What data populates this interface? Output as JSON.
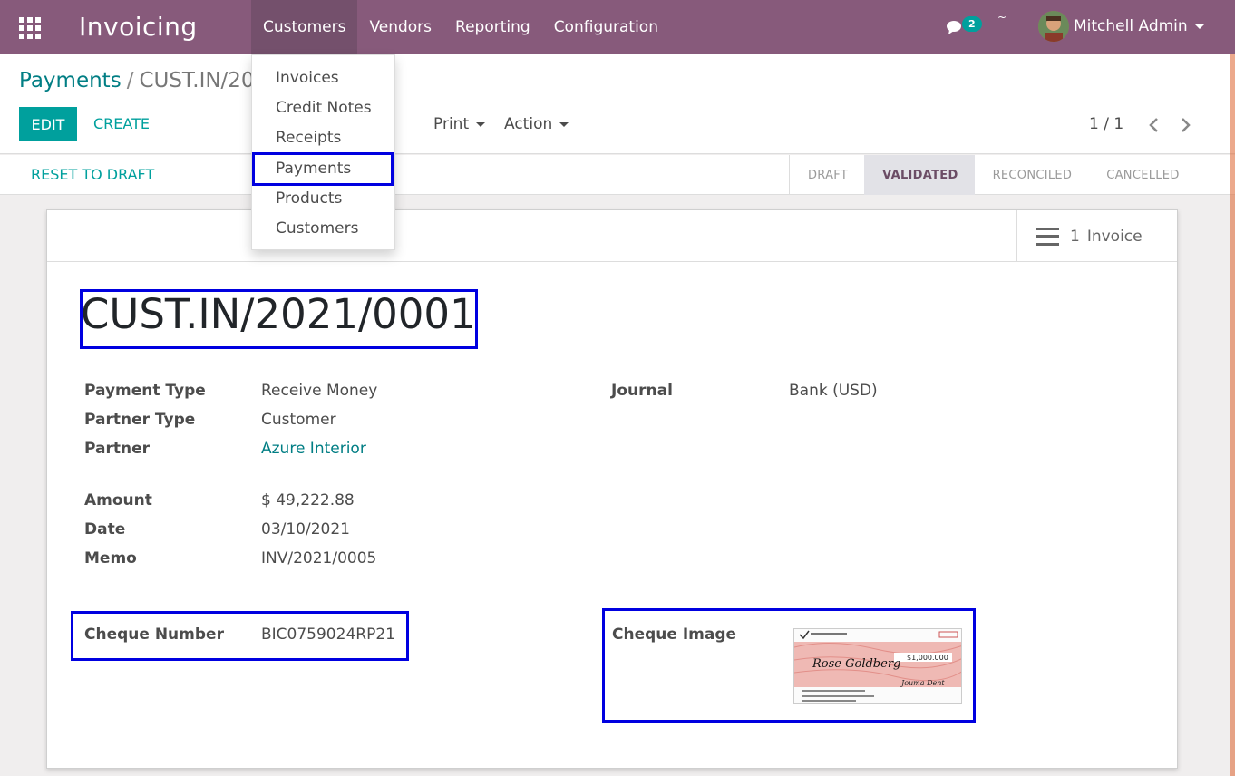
{
  "navbar": {
    "app_title": "Invoicing",
    "menu": [
      "Customers",
      "Vendors",
      "Reporting",
      "Configuration"
    ],
    "chat_count": "2",
    "tilde": "~",
    "user_name": "Mitchell Admin"
  },
  "breadcrumb": {
    "parent": "Payments",
    "separator": "/",
    "current": "CUST.IN/20"
  },
  "toolbar": {
    "edit_label": "EDIT",
    "create_label": "CREATE",
    "print_label": "Print",
    "action_label": "Action",
    "pager": "1 / 1"
  },
  "statusbar": {
    "reset_label": "RESET TO DRAFT",
    "stages": [
      "DRAFT",
      "VALIDATED",
      "RECONCILED",
      "CANCELLED"
    ],
    "current_stage": "VALIDATED"
  },
  "smart_button": {
    "count": "1",
    "label": "Invoice"
  },
  "record": {
    "name": "CUST.IN/2021/0001",
    "payment_type_label": "Payment Type",
    "payment_type": "Receive Money",
    "partner_type_label": "Partner Type",
    "partner_type": "Customer",
    "partner_label": "Partner",
    "partner": "Azure Interior",
    "amount_label": "Amount",
    "amount": "$ 49,222.88",
    "date_label": "Date",
    "date": "03/10/2021",
    "memo_label": "Memo",
    "memo": "INV/2021/0005",
    "journal_label": "Journal",
    "journal": "Bank (USD)",
    "cheque_number_label": "Cheque Number",
    "cheque_number": "BIC0759024RP21",
    "cheque_image_label": "Cheque Image",
    "cheque_payee": "Rose Goldberg",
    "cheque_amount": "$1,000.000",
    "cheque_signature": "Jouma Dent"
  },
  "dropdown": {
    "items": [
      "Invoices",
      "Credit Notes",
      "Receipts",
      "Payments",
      "Products",
      "Customers"
    ]
  },
  "colors": {
    "navbar": "#875a7b",
    "accent": "#00a09d",
    "highlight": "#0000e0"
  }
}
